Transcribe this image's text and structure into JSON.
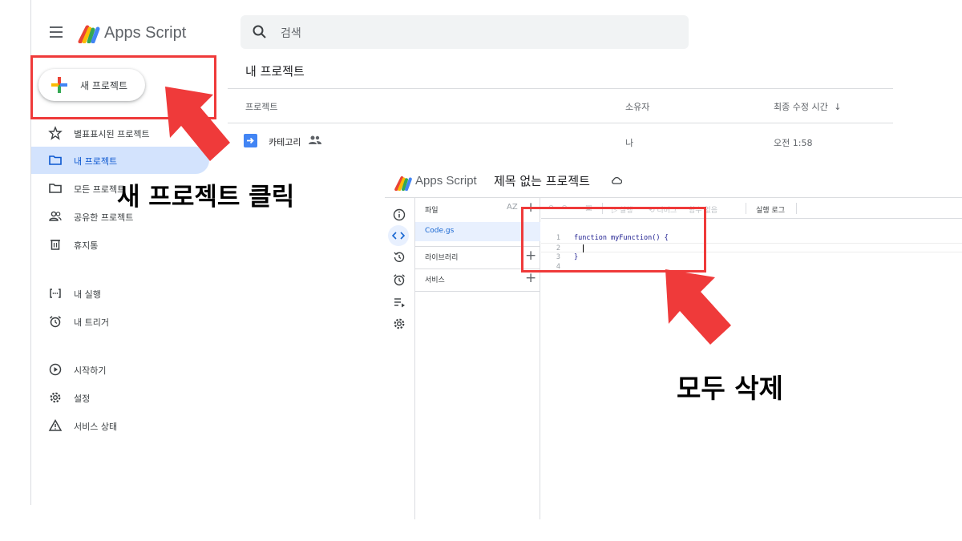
{
  "app": {
    "brand": "Apps Script"
  },
  "search": {
    "placeholder": "검색"
  },
  "sidebar": {
    "new_project_label": "새 프로젝트",
    "items": [
      {
        "label": "별표표시된 프로젝트",
        "icon": "star-icon"
      },
      {
        "label": "내 프로젝트",
        "icon": "folder-icon",
        "active": true
      },
      {
        "label": "모든 프로젝트",
        "icon": "folder-icon"
      },
      {
        "label": "공유한 프로젝트",
        "icon": "people-icon"
      },
      {
        "label": "휴지통",
        "icon": "trash-icon"
      },
      {
        "label": "내 실행",
        "icon": "executions-icon"
      },
      {
        "label": "내 트리거",
        "icon": "alarm-icon"
      },
      {
        "label": "시작하기",
        "icon": "play-circle-icon"
      },
      {
        "label": "설정",
        "icon": "gear-icon"
      },
      {
        "label": "서비스 상태",
        "icon": "warning-icon"
      }
    ]
  },
  "main": {
    "title": "내 프로젝트",
    "columns": {
      "project": "프로젝트",
      "owner": "소유자",
      "modified": "최종 수정 시간"
    },
    "rows": [
      {
        "name": "카테고리",
        "owner": "나",
        "modified": "오전 1:58"
      }
    ]
  },
  "editor": {
    "brand": "Apps Script",
    "title": "제목 없는 프로젝트",
    "files_label": "파일",
    "sort_label": "AZ",
    "file_name": "Code.gs",
    "libraries_label": "라이브러리",
    "services_label": "서비스",
    "toolbar": {
      "run": "실행",
      "debug": "디버그",
      "no_function": "함수 없음",
      "log": "실행 로그"
    },
    "code": {
      "line_numbers": [
        "1",
        "2",
        "3",
        "4"
      ],
      "line1": "function myFunction() {",
      "line3": "}"
    }
  },
  "annotations": {
    "click_new_project": "새 프로젝트 클릭",
    "delete_all": "모두 삭제",
    "color": "#ef3a3a"
  },
  "colors": {
    "active_nav": "#d3e3fd",
    "accent_blue": "#0b57d0",
    "annotation_red": "#ef3a3a"
  }
}
